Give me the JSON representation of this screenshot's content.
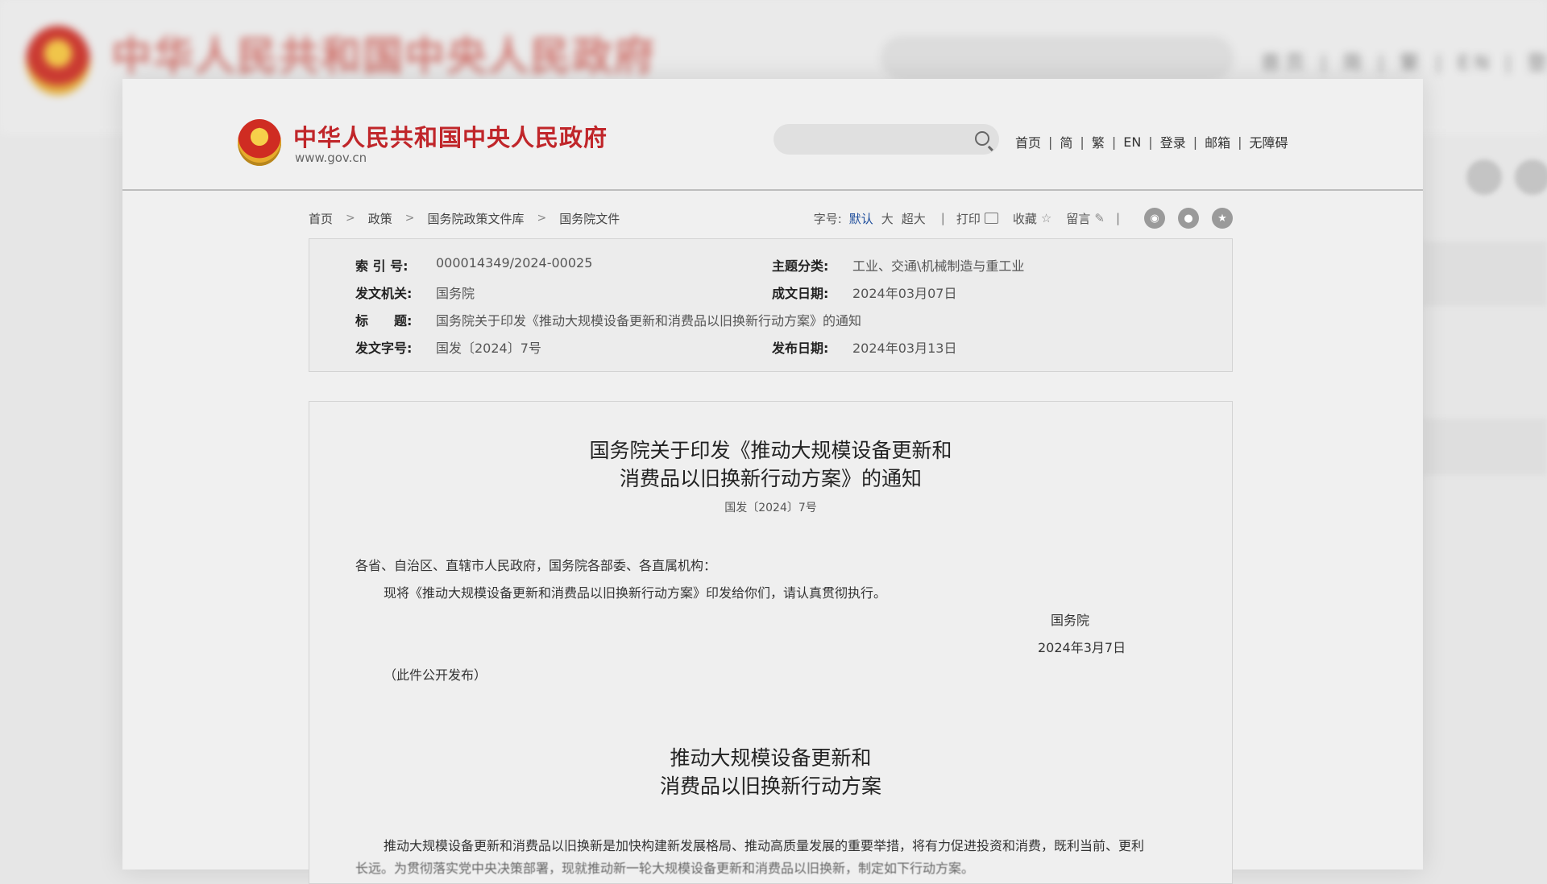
{
  "background": {
    "title": "中华人民共和国中央人民政府",
    "nav": "首页 | 简 | 繁 | EN | 登录"
  },
  "header": {
    "site_title": "中华人民共和国中央人民政府",
    "site_url": "www.gov.cn",
    "search_placeholder": "",
    "nav": [
      "首页",
      "简",
      "繁",
      "EN",
      "登录",
      "邮箱",
      "无障碍"
    ]
  },
  "breadcrumb": [
    "首页",
    "政策",
    "国务院政策文件库",
    "国务院文件"
  ],
  "tools": {
    "font_size_label": "字号:",
    "font_sizes": [
      "默认",
      "大",
      "超大"
    ],
    "print": "打印",
    "favorite": "收藏",
    "comment": "留言"
  },
  "meta": {
    "index_label": "索 引 号:",
    "index_value": "000014349/2024-00025",
    "category_label": "主题分类:",
    "category_value": "工业、交通\\机械制造与重工业",
    "issuer_label": "发文机关:",
    "issuer_value": "国务院",
    "written_label": "成文日期:",
    "written_value": "2024年03月07日",
    "title_label": "标　　题:",
    "title_value": "国务院关于印发《推动大规模设备更新和消费品以旧换新行动方案》的通知",
    "docno_label": "发文字号:",
    "docno_value": "国发〔2024〕7号",
    "published_label": "发布日期:",
    "published_value": "2024年03月13日"
  },
  "document": {
    "title_line1": "国务院关于印发《推动大规模设备更新和",
    "title_line2": "消费品以旧换新行动方案》的通知",
    "doc_number": "国发〔2024〕7号",
    "salutation": "各省、自治区、直辖市人民政府，国务院各部委、各直属机构：",
    "body": "现将《推动大规模设备更新和消费品以旧换新行动方案》印发给你们，请认真贯彻执行。",
    "signer": "国务院",
    "date": "2024年3月7日",
    "note": "（此件公开发布）",
    "plan_title_line1": "推动大规模设备更新和",
    "plan_title_line2": "消费品以旧换新行动方案",
    "plan_para": "推动大规模设备更新和消费品以旧换新是加快构建新发展格局、推动高质量发展的重要举措，将有力促进投资和消费，既利当前、更利",
    "plan_para_cont": "长远。为贯彻落实党中央决策部署，现就推动新一轮大规模设备更新和消费品以旧换新，制定如下行动方案。"
  }
}
